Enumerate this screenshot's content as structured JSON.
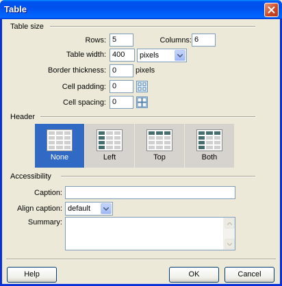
{
  "window": {
    "title": "Table"
  },
  "table_size": {
    "heading": "Table size",
    "rows_label": "Rows:",
    "rows_value": "5",
    "columns_label": "Columns:",
    "columns_value": "6",
    "width_label": "Table width:",
    "width_value": "400",
    "width_unit": "pixels",
    "border_label": "Border thickness:",
    "border_value": "0",
    "border_unit": "pixels",
    "padding_label": "Cell padding:",
    "padding_value": "0",
    "spacing_label": "Cell spacing:",
    "spacing_value": "0"
  },
  "header": {
    "heading": "Header",
    "options": [
      {
        "label": "None",
        "selected": true
      },
      {
        "label": "Left",
        "selected": false
      },
      {
        "label": "Top",
        "selected": false
      },
      {
        "label": "Both",
        "selected": false
      }
    ]
  },
  "accessibility": {
    "heading": "Accessibility",
    "caption_label": "Caption:",
    "caption_value": "",
    "align_label": "Align caption:",
    "align_value": "default",
    "summary_label": "Summary:",
    "summary_value": ""
  },
  "buttons": {
    "help": "Help",
    "ok": "OK",
    "cancel": "Cancel"
  },
  "colors": {
    "selected_bg": "#316AC5",
    "header_cell": "#466E6E",
    "titlebar": "#0054E3"
  }
}
